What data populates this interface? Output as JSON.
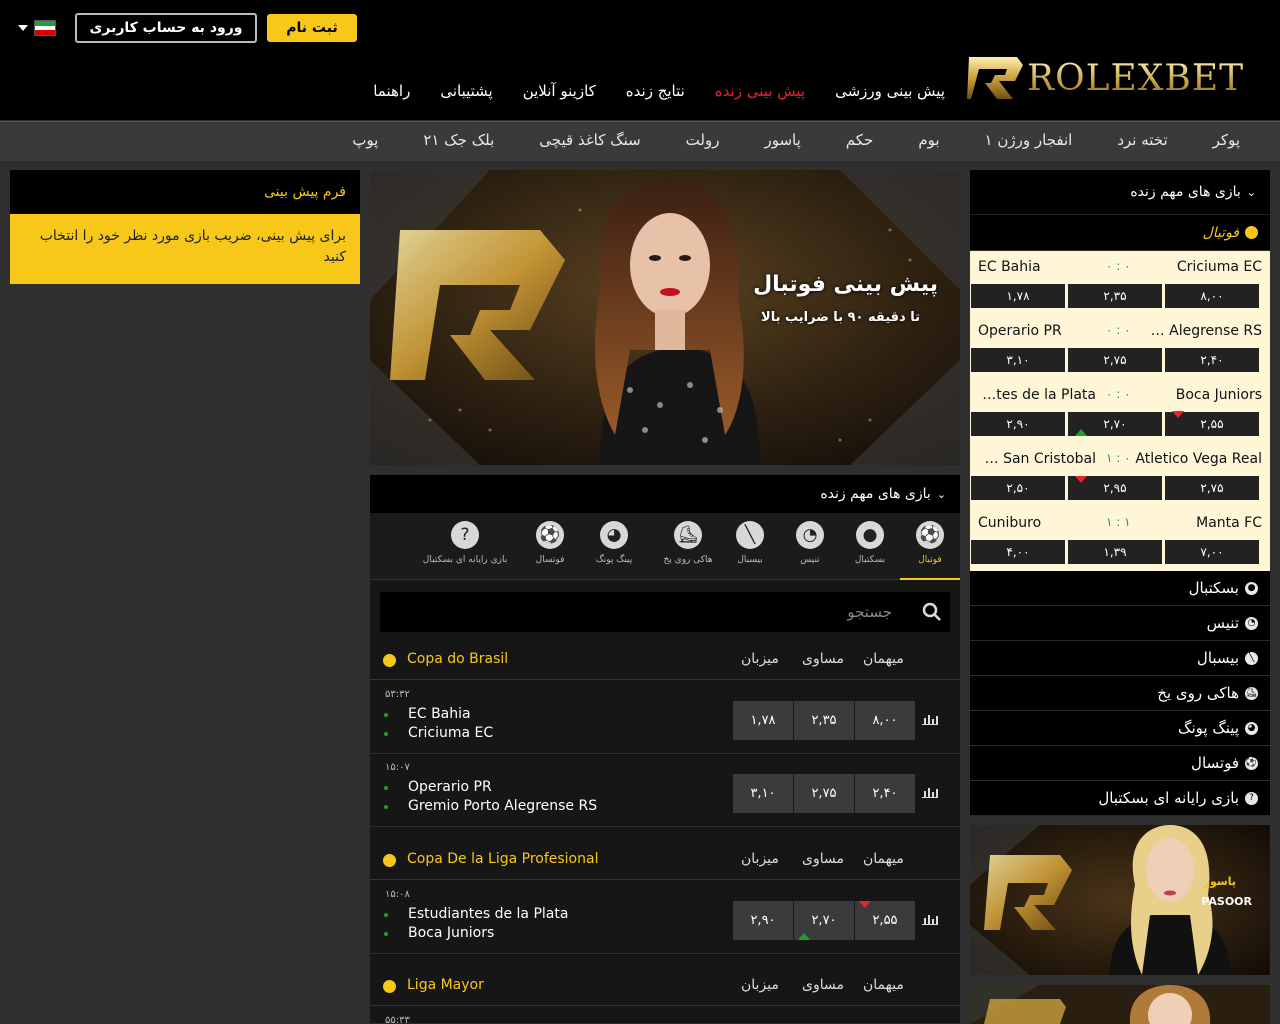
{
  "header": {
    "language": {
      "selected": "fa",
      "flag": "iran-flag"
    },
    "login_button": "ورود به حساب کاربری",
    "register_button": "ثبت نام",
    "logo_text": "ROLEXBET",
    "main_nav": [
      {
        "label": "پیش بینی ورزشی",
        "active": false
      },
      {
        "label": "پیش بینی زنده",
        "active": true
      },
      {
        "label": "نتایج زنده",
        "active": false
      },
      {
        "label": "کازینو آنلاین",
        "active": false
      },
      {
        "label": "پشتیبانی",
        "active": false
      },
      {
        "label": "راهنما",
        "active": false
      }
    ],
    "games_nav": [
      "پوکر",
      "تخته نرد",
      "انفجار ورژن ۱",
      "بوم",
      "حکم",
      "پاسور",
      "رولت",
      "سنگ کاغذ قیچی",
      "بلک جک ۲۱",
      "پوپ"
    ]
  },
  "bet_form": {
    "title": "فرم پیش بینی",
    "hint": "برای پیش بینی، ضریب بازی مورد نظر خود را انتخاب کنید"
  },
  "banner": {
    "title": "پیش بینی فوتبال",
    "subtitle": "تا دقیقه ۹۰ با ضرایب بالا"
  },
  "live_center": {
    "title": "بازی های مهم زنده",
    "sport_tabs": [
      {
        "label": "فوتبال",
        "icon": "football-icon",
        "active": true
      },
      {
        "label": "بسکتبال",
        "icon": "basketball-icon",
        "active": false
      },
      {
        "label": "تنیس",
        "icon": "tennis-icon",
        "active": false
      },
      {
        "label": "بیسبال",
        "icon": "baseball-icon",
        "active": false
      },
      {
        "label": "هاکی روی یخ",
        "icon": "ice-hockey-icon",
        "active": false
      },
      {
        "label": "پینگ پونگ",
        "icon": "ping-pong-icon",
        "active": false
      },
      {
        "label": "فوتسال",
        "icon": "futsal-icon",
        "active": false
      },
      {
        "label": "بازی رایانه ای بسکتبال",
        "icon": "e-basketball-icon",
        "active": false
      }
    ],
    "search_placeholder": "جستجو",
    "columns": {
      "home": "میزبان",
      "draw": "مساوی",
      "away": "میهمان"
    },
    "leagues": [
      {
        "name": "Copa do Brasil",
        "matches": [
          {
            "time": "۵۳:۳۲",
            "team1": "EC Bahia",
            "team2": "Criciuma EC",
            "odds": [
              "۱,۷۸",
              "۲,۳۵",
              "۸,۰۰"
            ]
          },
          {
            "time": "۱۵:۰۷",
            "team1": "Operario PR",
            "team2": "Gremio Porto Alegrense RS",
            "odds": [
              "۳,۱۰",
              "۲,۷۵",
              "۲,۴۰"
            ]
          }
        ]
      },
      {
        "name": "Copa De la Liga Profesional",
        "matches": [
          {
            "time": "۱۵:۰۸",
            "team1": "Estudiantes de la Plata",
            "team2": "Boca Juniors",
            "odds": [
              "۲,۹۰",
              "۲,۷۰",
              "۲,۵۵"
            ]
          }
        ]
      },
      {
        "name": "Liga Mayor",
        "matches": [
          {
            "time": "۵۵:۳۳"
          }
        ]
      }
    ]
  },
  "live_sidebar": {
    "title": "بازی های مهم زنده",
    "sport": "فوتبال",
    "matches": [
      {
        "home": "Criciuma EC",
        "away": "EC Bahia",
        "score": "۰ : ۰",
        "odds": [
          "۸,۰۰",
          "۲,۳۵",
          "۱,۷۸"
        ]
      },
      {
        "home": "Gremio Porto Alegrense RS",
        "away": "Operario PR",
        "score": "۰ : ۰",
        "odds": [
          "۲,۴۰",
          "۲,۷۵",
          "۳,۱۰"
        ]
      },
      {
        "home": "Boca Juniors",
        "away": "Estudiantes de la Plata",
        "score": "۰ : ۰",
        "odds": [
          "۲,۵۵",
          "۲,۷۰",
          "۲,۹۰"
        ]
      },
      {
        "home": "Atletico Vega Real",
        "away": "Cibao San Cristobal",
        "score": "۱ : ۰",
        "odds": [
          "۲,۷۵",
          "۲,۹۵",
          "۲,۵۰"
        ]
      },
      {
        "home": "Manta FC",
        "away": "Cuniburo",
        "score": "۱ : ۱",
        "odds": [
          "۷,۰۰",
          "۱,۳۹",
          "۴,۰۰"
        ]
      }
    ],
    "sports_list": [
      {
        "label": "بسکتبال",
        "icon": "basketball-icon"
      },
      {
        "label": "تنیس",
        "icon": "tennis-icon"
      },
      {
        "label": "بیسبال",
        "icon": "baseball-icon"
      },
      {
        "label": "هاکی روی یخ",
        "icon": "ice-hockey-icon"
      },
      {
        "label": "پینگ پونگ",
        "icon": "ping-pong-icon"
      },
      {
        "label": "فوتسال",
        "icon": "futsal-icon"
      },
      {
        "label": "بازی رایانه ای بسکتبال",
        "icon": "e-basketball-icon"
      }
    ]
  },
  "promos": [
    {
      "title": "پاسور",
      "subtitle": "PASOOR"
    }
  ],
  "colors": {
    "accent": "#f7c81a",
    "active_nav": "#e5262b",
    "up": "#1f9d2e",
    "down": "#e5262b",
    "panel": "#000000",
    "background": "#2f2f2f"
  }
}
